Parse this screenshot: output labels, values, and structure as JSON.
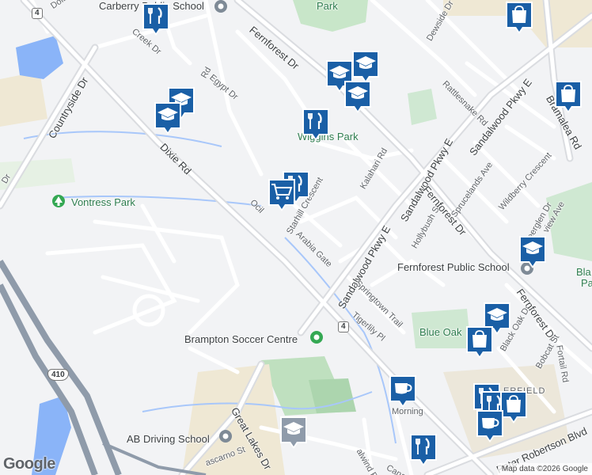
{
  "map": {
    "labels": {
      "carberry_school": "Carberry Public School",
      "dolby": "Dolby",
      "creek": "Creek Dr",
      "rd_top": "Rd",
      "egypt": "Egypt Dr",
      "fernforest_top": "Fernforest Dr",
      "park_top": "Park",
      "dewside": "Dewside Dr",
      "rattlesnake": "Rattlesnake Rd",
      "countryside": "Countryside Dr",
      "dixie": "Dixie Rd",
      "wiggins_park": "Wiggins Park",
      "kalahari": "Kalahari Rd",
      "ocil": "Ocil",
      "starhill": "Starhill Crescent",
      "arabia": "Arabia Gate",
      "sandalwood_1": "Sandalwood Pkwy E",
      "sandalwood_2": "Sandalwood Pkwy E",
      "sandalwood_3": "Sandalwood Pkwy E",
      "hollybush": "Hollybush St",
      "sprucelands": "Sprucelands Ave",
      "wildberry": "Wildberry Crescent",
      "fernforest_mid": "Fernforest Dr",
      "bramalea": "Bramalea Rd",
      "deerglen": "Deerglen Dr",
      "view_ave": "view Ave",
      "fernforest_school": "Fernforest Public School",
      "bla": "Bla",
      "pa": "Pa",
      "vontress_park": "Vontress Park",
      "springtown": "Springtown Trail",
      "tigerlily": "Tigerlily Pl",
      "blue_oak": "Blue Oak",
      "black_oak": "Black Oak Dr",
      "fernforest_bottom": "Fernforest Dr",
      "bobcat": "Bobcat St",
      "fortail": "Fortail Rd",
      "brampton_soccer": "Brampton Soccer Centre",
      "erfield": "ERFIELD",
      "peter_robertson": "Peter Robertson Blvd",
      "morning": "Morning",
      "great_lakes": "Great Lakes Dr",
      "ab_driving": "AB Driving School",
      "dr_left": "Dr",
      "alwind": "alwind Rd",
      "cana": "Cana",
      "scarno": "ascarno St"
    },
    "shields": {
      "route4_top": "4",
      "route4_mid": "4",
      "hwy410": "410"
    },
    "colors": {
      "road": "#ffffff",
      "arterial": "#dadce0",
      "park": "#c8e6c9",
      "water": "#8ab4f8",
      "highway": "#8f9baa",
      "pin": "#1a5fa6"
    },
    "logo": "Google",
    "attribution": "Map data ©2026 Google"
  }
}
